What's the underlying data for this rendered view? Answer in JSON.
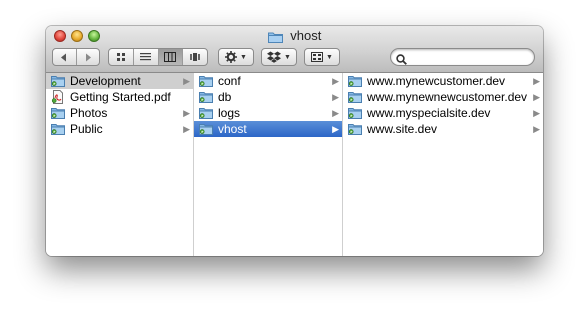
{
  "window": {
    "title": "vhost"
  },
  "toolbar": {
    "back_icon": "back-arrow-icon",
    "forward_icon": "forward-arrow-icon",
    "view_modes": [
      "icon-view-icon",
      "list-view-icon",
      "column-view-icon",
      "coverflow-view-icon"
    ],
    "action_icon": "gear-icon",
    "dropbox_icon": "dropbox-icon",
    "arrange_icon": "arrange-icon",
    "search": {
      "value": "",
      "placeholder": ""
    }
  },
  "columns": [
    {
      "items": [
        {
          "label": "Development",
          "icon": "folder-icon",
          "has_children": true,
          "state": "selected-gray"
        },
        {
          "label": "Getting Started.pdf",
          "icon": "pdf-icon",
          "has_children": false,
          "state": ""
        },
        {
          "label": "Photos",
          "icon": "folder-icon",
          "has_children": true,
          "state": ""
        },
        {
          "label": "Public",
          "icon": "folder-icon",
          "has_children": true,
          "state": ""
        }
      ]
    },
    {
      "items": [
        {
          "label": "conf",
          "icon": "folder-icon",
          "has_children": true,
          "state": ""
        },
        {
          "label": "db",
          "icon": "folder-icon",
          "has_children": true,
          "state": ""
        },
        {
          "label": "logs",
          "icon": "folder-icon",
          "has_children": true,
          "state": ""
        },
        {
          "label": "vhost",
          "icon": "folder-icon",
          "has_children": true,
          "state": "selected-blue"
        }
      ]
    },
    {
      "items": [
        {
          "label": "www.mynewcustomer.dev",
          "icon": "folder-icon",
          "has_children": true,
          "state": ""
        },
        {
          "label": "www.mynewnewcustomer.dev",
          "icon": "folder-icon",
          "has_children": true,
          "state": ""
        },
        {
          "label": "www.myspecialsite.dev",
          "icon": "folder-icon",
          "has_children": true,
          "state": ""
        },
        {
          "label": "www.site.dev",
          "icon": "folder-icon",
          "has_children": true,
          "state": ""
        }
      ]
    }
  ],
  "colors": {
    "selection_blue": "#3a75d0",
    "selection_gray": "#cfcfcf",
    "folder_blue": "#7fb2e0"
  }
}
